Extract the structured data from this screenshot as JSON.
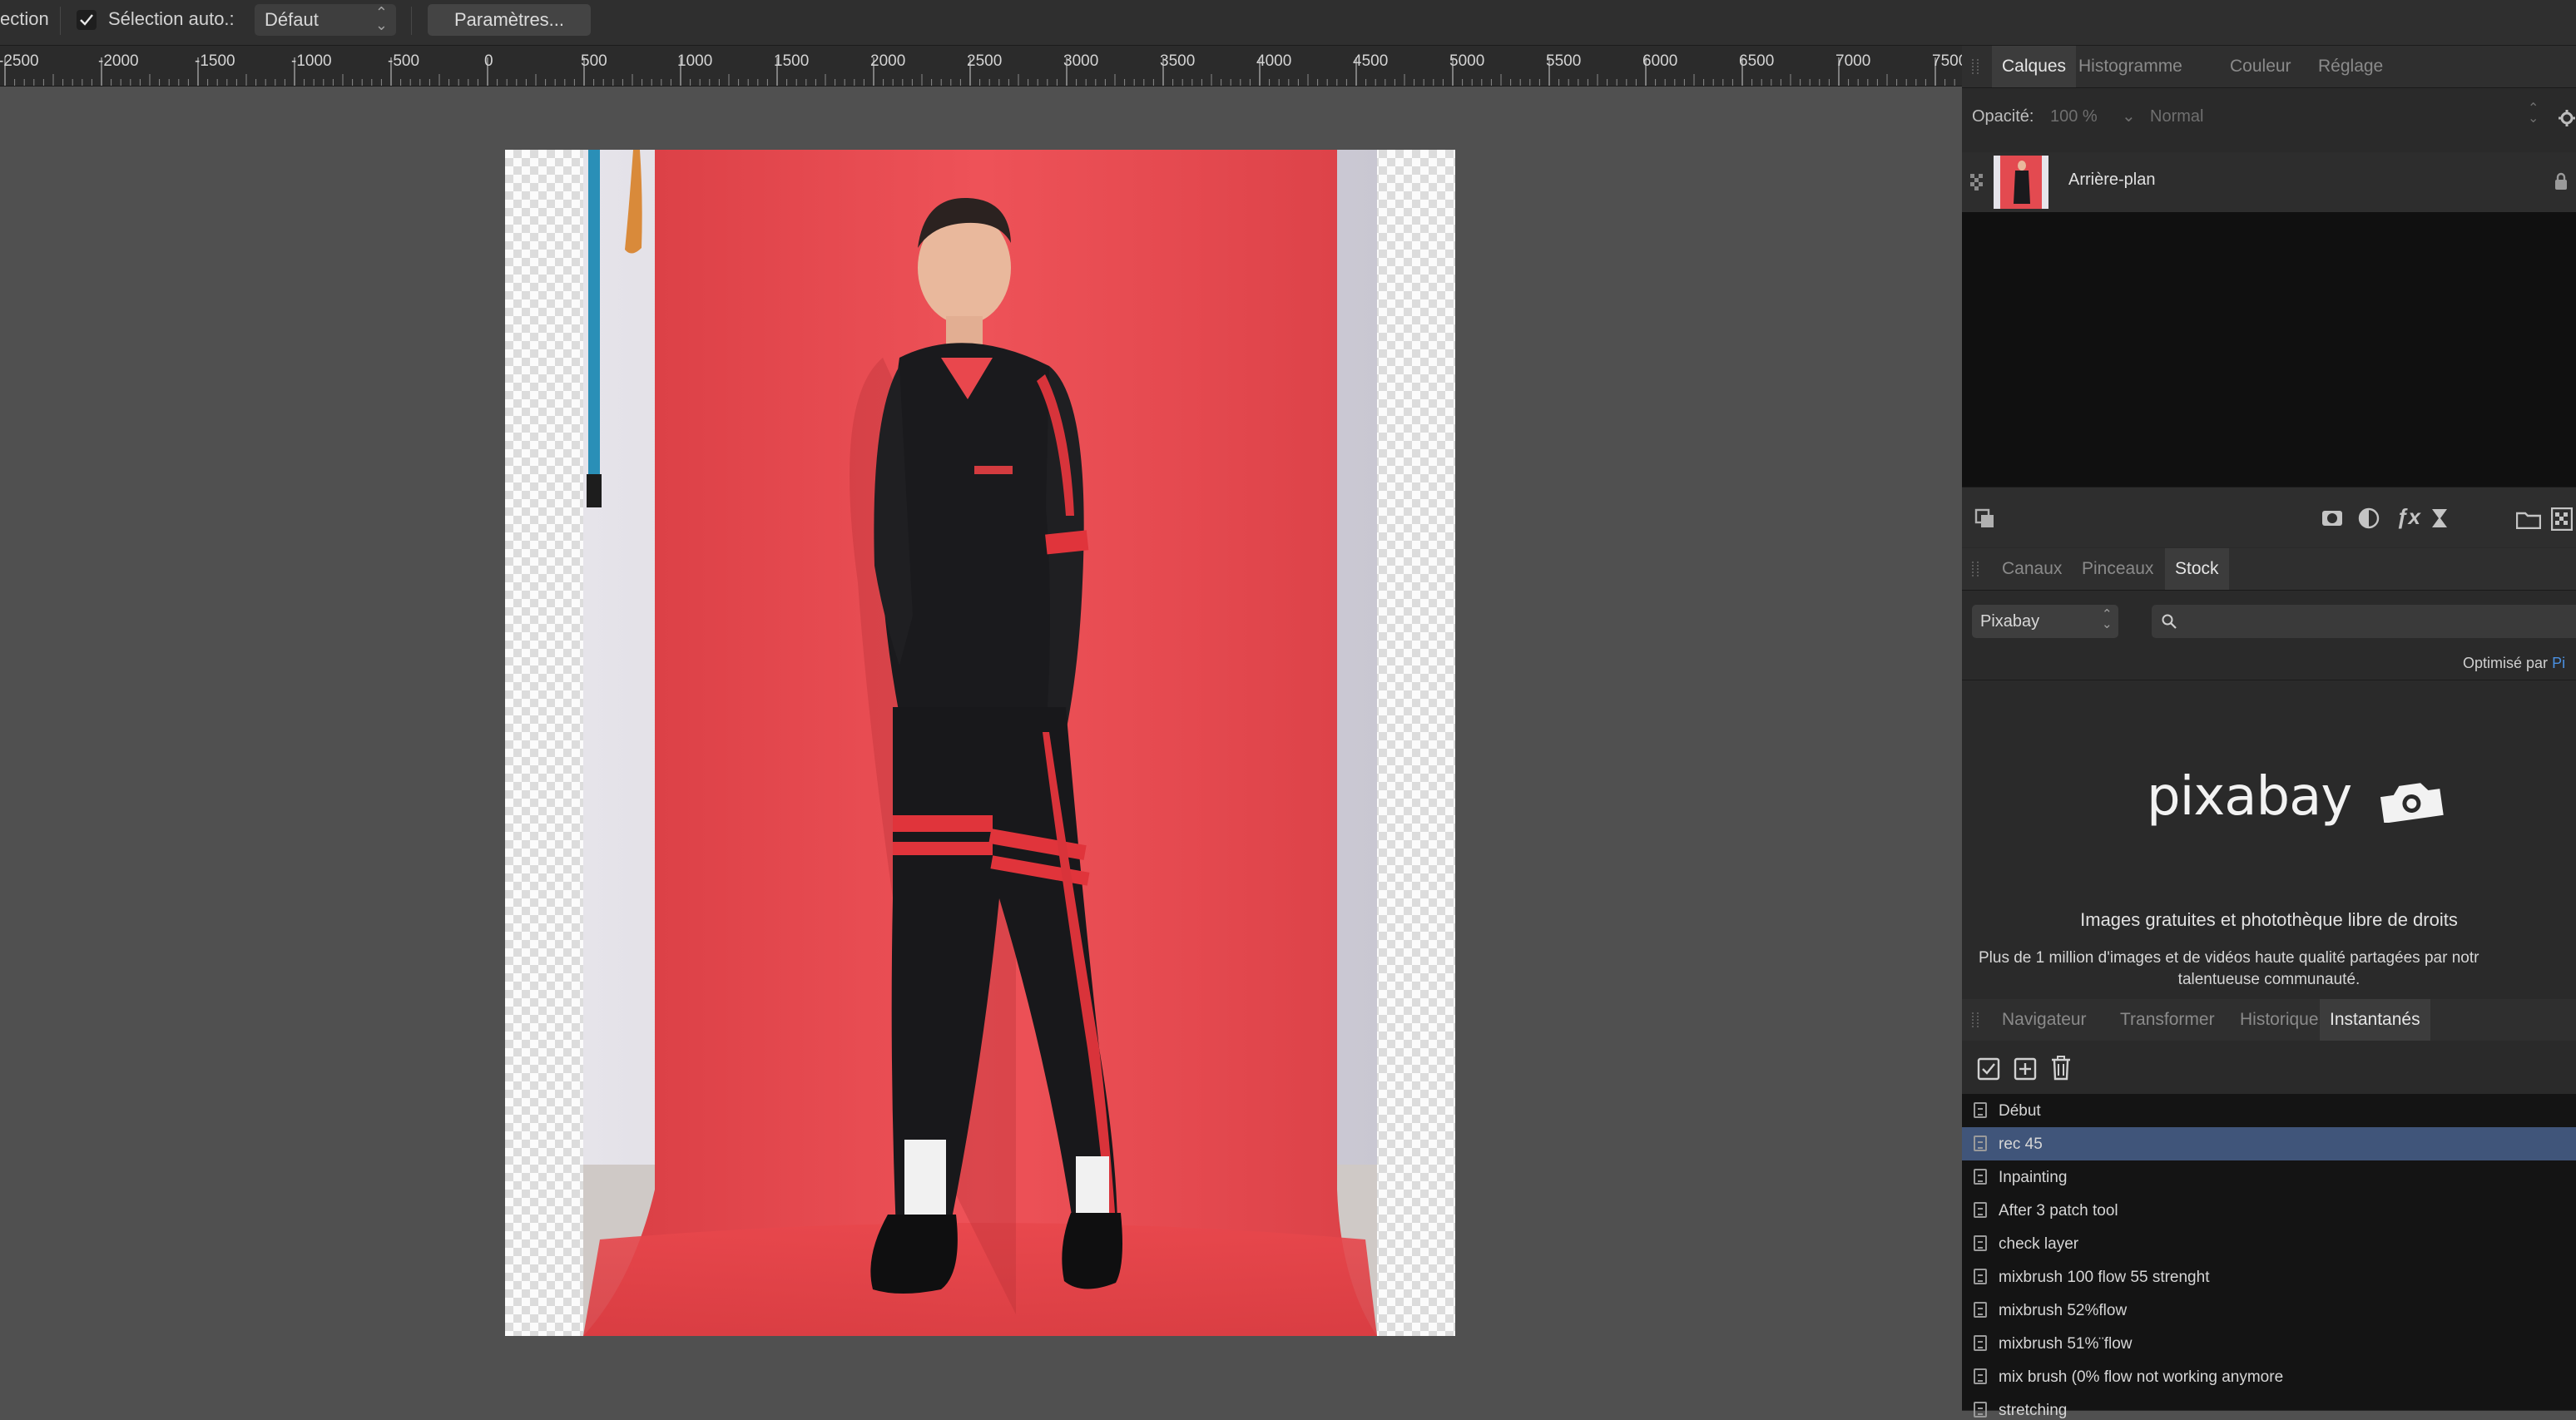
{
  "toolbar": {
    "tool_name_partial": "ection",
    "auto_select_label": "Sélection auto.:",
    "auto_select_checked": true,
    "auto_select_value": "Défaut",
    "settings_button": "Paramètres..."
  },
  "ruler": {
    "labels": [
      "-2500",
      "-2000",
      "-1500",
      "-1000",
      "-500",
      "0",
      "500",
      "1000",
      "1500",
      "2000",
      "2500",
      "3000",
      "3500",
      "4000",
      "4500",
      "5000",
      "5500",
      "6000",
      "6500",
      "7000",
      "7500"
    ]
  },
  "layers_panel": {
    "tabs": [
      "Calques",
      "Histogramme",
      "Couleur",
      "Réglage"
    ],
    "active_tab": "Calques",
    "opacity_label": "Opacité:",
    "opacity_value": "100 %",
    "blend_mode": "Normal",
    "layer_name": "Arrière-plan",
    "layer_locked": true
  },
  "stock_panel": {
    "tabs": [
      "Canaux",
      "Pinceaux",
      "Stock"
    ],
    "active_tab": "Stock",
    "source": "Pixabay",
    "search_placeholder": "",
    "powered_by_label": "Optimisé par",
    "powered_by_link": "Pi",
    "logo_text": "pixabay",
    "headline": "Images gratuites et photothèque libre de droits",
    "description_line1": "Plus de 1 million d'images et de vidéos haute qualité partagées par notr",
    "description_line2": "talentueuse communauté."
  },
  "snapshots_panel": {
    "tabs": [
      "Navigateur",
      "Transformer",
      "Historique",
      "Instantanés"
    ],
    "active_tab": "Instantanés",
    "items": [
      "Début",
      "rec 45",
      "Inpainting",
      "After 3 patch tool",
      "check layer",
      "mixbrush 100 flow 55 strenght",
      "mixbrush 52%flow",
      "mixbrush 51%¨flow",
      "mix brush (0% flow not working anymore",
      "stretching"
    ],
    "selected_index": 1
  },
  "colors": {
    "panel_bg": "#2a2a2a",
    "canvas_bg": "#505050",
    "selection": "#40557a",
    "backdrop_red": "#e9484c",
    "link_blue": "#4a90e2"
  }
}
